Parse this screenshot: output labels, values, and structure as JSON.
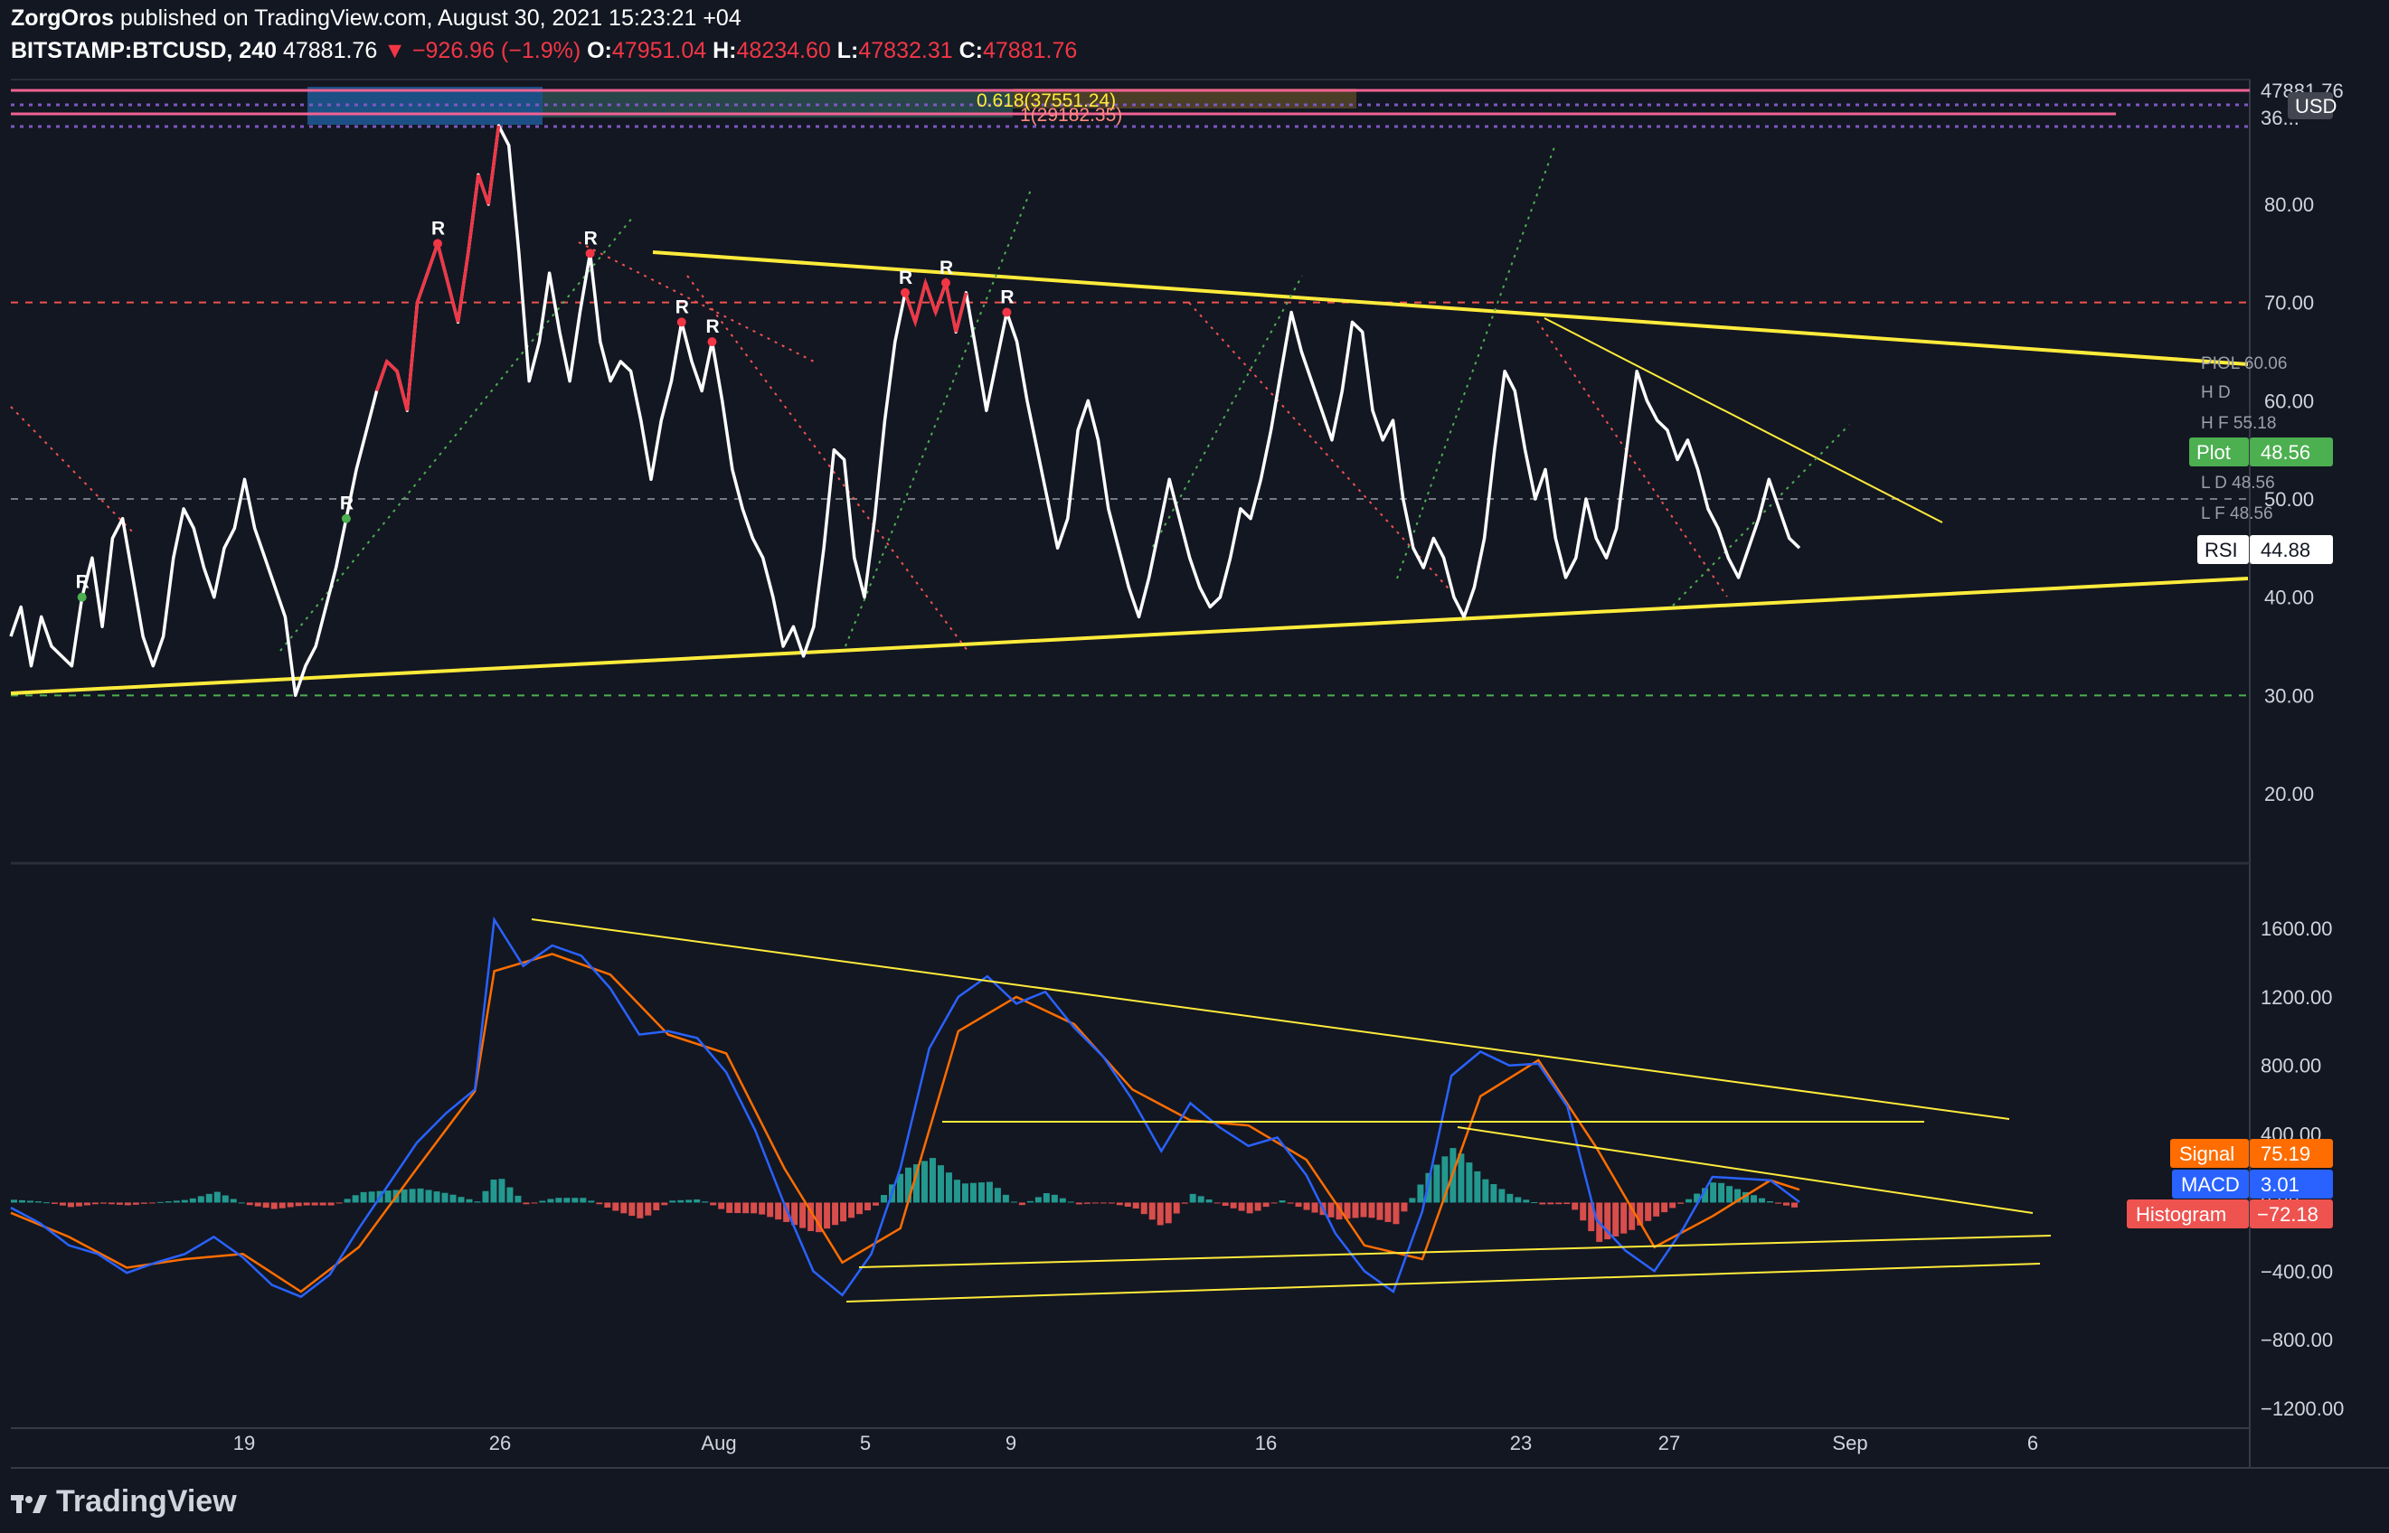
{
  "header": {
    "author": "ZorgOros",
    "published_text": "published on TradingView.com, August 30, 2021 15:23:21 +04"
  },
  "symbol_bar": {
    "symbol": "BITSTAMP:BTCUSD, 240",
    "last": "47881.76",
    "change": "−926.96 (−1.9%)",
    "open_label": "O:",
    "open": "47951.04",
    "high_label": "H:",
    "high": "48234.60",
    "low_label": "L:",
    "low": "47832.31",
    "close_label": "C:",
    "close": "47881.76"
  },
  "price_strip": {
    "fib_label": "0.618(37551.24)",
    "level_label": "1(29182.35)",
    "right_value_1": "47881.76",
    "right_value_2": "36...",
    "currency": "USD"
  },
  "rsi_axis": {
    "ticks": [
      "80.00",
      "70.00",
      "60.00",
      "50.00",
      "40.00",
      "30.00",
      "20.00"
    ]
  },
  "macd_axis": {
    "ticks": [
      "1600.00",
      "1200.00",
      "800.00",
      "400.00",
      "0.00",
      "−400.00",
      "−800.00",
      "−1200.00"
    ]
  },
  "time_axis": {
    "ticks": [
      "19",
      "26",
      "Aug",
      "5",
      "9",
      "16",
      "23",
      "27",
      "Sep",
      "6"
    ]
  },
  "rsi_side_labels": [
    "PIOL 60.06",
    "H D",
    "H F 55.18",
    "L D 48.56",
    "L F 48.56"
  ],
  "tags": {
    "plot_label": "Plot",
    "plot_value": "48.56",
    "rsi_label": "RSI",
    "rsi_value": "44.88",
    "signal_label": "Signal",
    "signal_value": "75.19",
    "macd_label": "MACD",
    "macd_value": "3.01",
    "hist_label": "Histogram",
    "hist_value": "−72.18"
  },
  "r_marker": "R",
  "colors": {
    "background": "#131722",
    "rsi_line": "#ffffff",
    "rsi_bear": "#f23645",
    "trendline": "#ffeb3b",
    "macd": "#2962ff",
    "signal": "#ff6d00",
    "hist_pos": "#26a69a",
    "hist_neg": "#ef5350",
    "plot_tag": "#4caf50"
  },
  "footer": {
    "brand": "TradingView"
  },
  "chart_data": [
    {
      "type": "line",
      "title": "",
      "series": [
        {
          "name": "RSI",
          "values": []
        }
      ],
      "x": [
        "19",
        "26",
        "Aug",
        "5",
        "9",
        "16",
        "23",
        "27",
        "Sep",
        "6"
      ],
      "ylim": [
        10,
        90
      ],
      "reference_lines": [
        70,
        50,
        30
      ],
      "rsi_points": [
        [
          0,
          36
        ],
        [
          1,
          39
        ],
        [
          2,
          33
        ],
        [
          3,
          38
        ],
        [
          4,
          35
        ],
        [
          5,
          34
        ],
        [
          6,
          33
        ],
        [
          7,
          40
        ],
        [
          8,
          44
        ],
        [
          9,
          37
        ],
        [
          10,
          46
        ],
        [
          11,
          48
        ],
        [
          12,
          42
        ],
        [
          13,
          36
        ],
        [
          14,
          33
        ],
        [
          15,
          36
        ],
        [
          16,
          44
        ],
        [
          17,
          49
        ],
        [
          18,
          47
        ],
        [
          19,
          43
        ],
        [
          20,
          40
        ],
        [
          21,
          45
        ],
        [
          22,
          47
        ],
        [
          23,
          52
        ],
        [
          24,
          47
        ],
        [
          25,
          44
        ],
        [
          26,
          41
        ],
        [
          27,
          38
        ],
        [
          28,
          30
        ],
        [
          29,
          33
        ],
        [
          30,
          35
        ],
        [
          31,
          39
        ],
        [
          32,
          43
        ],
        [
          33,
          48
        ],
        [
          34,
          53
        ],
        [
          35,
          57
        ],
        [
          36,
          61
        ],
        [
          37,
          64
        ],
        [
          38,
          63
        ],
        [
          39,
          59
        ],
        [
          40,
          70
        ],
        [
          41,
          73
        ],
        [
          42,
          76
        ],
        [
          43,
          72
        ],
        [
          44,
          68
        ],
        [
          45,
          75
        ],
        [
          46,
          83
        ],
        [
          47,
          80
        ],
        [
          48,
          88
        ],
        [
          49,
          86
        ],
        [
          50,
          75
        ],
        [
          51,
          62
        ],
        [
          52,
          66
        ],
        [
          53,
          73
        ],
        [
          54,
          67
        ],
        [
          55,
          62
        ],
        [
          56,
          69
        ],
        [
          57,
          75
        ],
        [
          58,
          66
        ],
        [
          59,
          62
        ],
        [
          60,
          64
        ],
        [
          61,
          63
        ],
        [
          62,
          58
        ],
        [
          63,
          52
        ],
        [
          64,
          58
        ],
        [
          65,
          62
        ],
        [
          66,
          68
        ],
        [
          67,
          64
        ],
        [
          68,
          61
        ],
        [
          69,
          66
        ],
        [
          70,
          60
        ],
        [
          71,
          53
        ],
        [
          72,
          49
        ],
        [
          73,
          46
        ],
        [
          74,
          44
        ],
        [
          75,
          40
        ],
        [
          76,
          35
        ],
        [
          77,
          37
        ],
        [
          78,
          34
        ],
        [
          79,
          37
        ],
        [
          80,
          45
        ],
        [
          81,
          55
        ],
        [
          82,
          54
        ],
        [
          83,
          44
        ],
        [
          84,
          40
        ],
        [
          85,
          48
        ],
        [
          86,
          58
        ],
        [
          87,
          66
        ],
        [
          88,
          71
        ],
        [
          89,
          68
        ],
        [
          90,
          72
        ],
        [
          91,
          69
        ],
        [
          92,
          72
        ],
        [
          93,
          67
        ],
        [
          94,
          71
        ],
        [
          95,
          65
        ],
        [
          96,
          59
        ],
        [
          97,
          64
        ],
        [
          98,
          69
        ],
        [
          99,
          66
        ],
        [
          100,
          60
        ],
        [
          101,
          55
        ],
        [
          102,
          50
        ],
        [
          103,
          45
        ],
        [
          104,
          48
        ],
        [
          105,
          57
        ],
        [
          106,
          60
        ],
        [
          107,
          56
        ],
        [
          108,
          49
        ],
        [
          109,
          45
        ],
        [
          110,
          41
        ],
        [
          111,
          38
        ],
        [
          112,
          42
        ],
        [
          113,
          47
        ],
        [
          114,
          52
        ],
        [
          115,
          48
        ],
        [
          116,
          44
        ],
        [
          117,
          41
        ],
        [
          118,
          39
        ],
        [
          119,
          40
        ],
        [
          120,
          44
        ],
        [
          121,
          49
        ],
        [
          122,
          48
        ],
        [
          123,
          52
        ],
        [
          124,
          57
        ],
        [
          125,
          63
        ],
        [
          126,
          69
        ],
        [
          127,
          65
        ],
        [
          128,
          62
        ],
        [
          129,
          59
        ],
        [
          130,
          56
        ],
        [
          131,
          61
        ],
        [
          132,
          68
        ],
        [
          133,
          67
        ],
        [
          134,
          59
        ],
        [
          135,
          56
        ],
        [
          136,
          58
        ],
        [
          137,
          50
        ],
        [
          138,
          45
        ],
        [
          139,
          43
        ],
        [
          140,
          46
        ],
        [
          141,
          44
        ],
        [
          142,
          40
        ],
        [
          143,
          38
        ],
        [
          144,
          41
        ],
        [
          145,
          46
        ],
        [
          146,
          55
        ],
        [
          147,
          63
        ],
        [
          148,
          61
        ],
        [
          149,
          55
        ],
        [
          150,
          50
        ],
        [
          151,
          53
        ],
        [
          152,
          46
        ],
        [
          153,
          42
        ],
        [
          154,
          44
        ],
        [
          155,
          50
        ],
        [
          156,
          46
        ],
        [
          157,
          44
        ],
        [
          158,
          47
        ],
        [
          159,
          55
        ],
        [
          160,
          63
        ],
        [
          161,
          60
        ],
        [
          162,
          58
        ],
        [
          163,
          57
        ],
        [
          164,
          54
        ],
        [
          165,
          56
        ],
        [
          166,
          53
        ],
        [
          167,
          49
        ],
        [
          168,
          47
        ],
        [
          169,
          44
        ],
        [
          170,
          42
        ],
        [
          171,
          45
        ],
        [
          172,
          48
        ],
        [
          173,
          52
        ],
        [
          174,
          49
        ],
        [
          175,
          46
        ],
        [
          176,
          45
        ]
      ],
      "notes": "RSI(14) oscillating between ~29 and ~88, ranging within converging yellow trendlines"
    },
    {
      "type": "line",
      "title": "",
      "series": [
        {
          "name": "MACD",
          "values": []
        },
        {
          "name": "Signal",
          "values": []
        },
        {
          "name": "Histogram",
          "values": []
        }
      ],
      "ylim": [
        -1300,
        1800
      ],
      "macd_points": [
        [
          0,
          -30
        ],
        [
          3,
          -120
        ],
        [
          6,
          -250
        ],
        [
          9,
          -300
        ],
        [
          12,
          -410
        ],
        [
          15,
          -350
        ],
        [
          18,
          -300
        ],
        [
          21,
          -200
        ],
        [
          24,
          -320
        ],
        [
          27,
          -480
        ],
        [
          30,
          -550
        ],
        [
          33,
          -420
        ],
        [
          36,
          -150
        ],
        [
          39,
          100
        ],
        [
          42,
          350
        ],
        [
          45,
          520
        ],
        [
          48,
          660
        ],
        [
          50,
          1650
        ],
        [
          53,
          1380
        ],
        [
          56,
          1500
        ],
        [
          59,
          1440
        ],
        [
          62,
          1250
        ],
        [
          65,
          980
        ],
        [
          68,
          1000
        ],
        [
          71,
          960
        ],
        [
          74,
          760
        ],
        [
          77,
          420
        ],
        [
          80,
          -10
        ],
        [
          83,
          -400
        ],
        [
          86,
          -540
        ],
        [
          89,
          -300
        ],
        [
          92,
          200
        ],
        [
          95,
          900
        ],
        [
          98,
          1200
        ],
        [
          101,
          1320
        ],
        [
          104,
          1160
        ],
        [
          107,
          1230
        ],
        [
          110,
          1020
        ],
        [
          113,
          850
        ],
        [
          116,
          600
        ],
        [
          119,
          300
        ],
        [
          122,
          580
        ],
        [
          125,
          440
        ],
        [
          128,
          330
        ],
        [
          131,
          380
        ],
        [
          134,
          160
        ],
        [
          137,
          -180
        ],
        [
          140,
          -400
        ],
        [
          143,
          -520
        ],
        [
          146,
          -50
        ],
        [
          149,
          740
        ],
        [
          152,
          880
        ],
        [
          155,
          800
        ],
        [
          158,
          810
        ],
        [
          161,
          560
        ],
        [
          164,
          -100
        ],
        [
          167,
          -280
        ],
        [
          170,
          -400
        ],
        [
          173,
          -150
        ],
        [
          176,
          150
        ],
        [
          179,
          140
        ],
        [
          182,
          130
        ],
        [
          185,
          3
        ]
      ],
      "signal_points": [
        [
          0,
          -60
        ],
        [
          6,
          -200
        ],
        [
          12,
          -380
        ],
        [
          18,
          -330
        ],
        [
          24,
          -300
        ],
        [
          30,
          -520
        ],
        [
          36,
          -260
        ],
        [
          42,
          200
        ],
        [
          48,
          650
        ],
        [
          50,
          1350
        ],
        [
          56,
          1450
        ],
        [
          62,
          1330
        ],
        [
          68,
          980
        ],
        [
          74,
          870
        ],
        [
          80,
          200
        ],
        [
          86,
          -350
        ],
        [
          92,
          -150
        ],
        [
          98,
          1000
        ],
        [
          104,
          1200
        ],
        [
          110,
          1040
        ],
        [
          116,
          660
        ],
        [
          122,
          480
        ],
        [
          128,
          450
        ],
        [
          134,
          250
        ],
        [
          140,
          -250
        ],
        [
          146,
          -330
        ],
        [
          152,
          620
        ],
        [
          158,
          830
        ],
        [
          164,
          320
        ],
        [
          170,
          -260
        ],
        [
          176,
          -80
        ],
        [
          182,
          130
        ],
        [
          185,
          75
        ]
      ],
      "histogram_note": "Histogram oscillating between about −450 and +520",
      "trendlines": "Descending highs from ~1650 and converging lows around −500/−600"
    }
  ]
}
